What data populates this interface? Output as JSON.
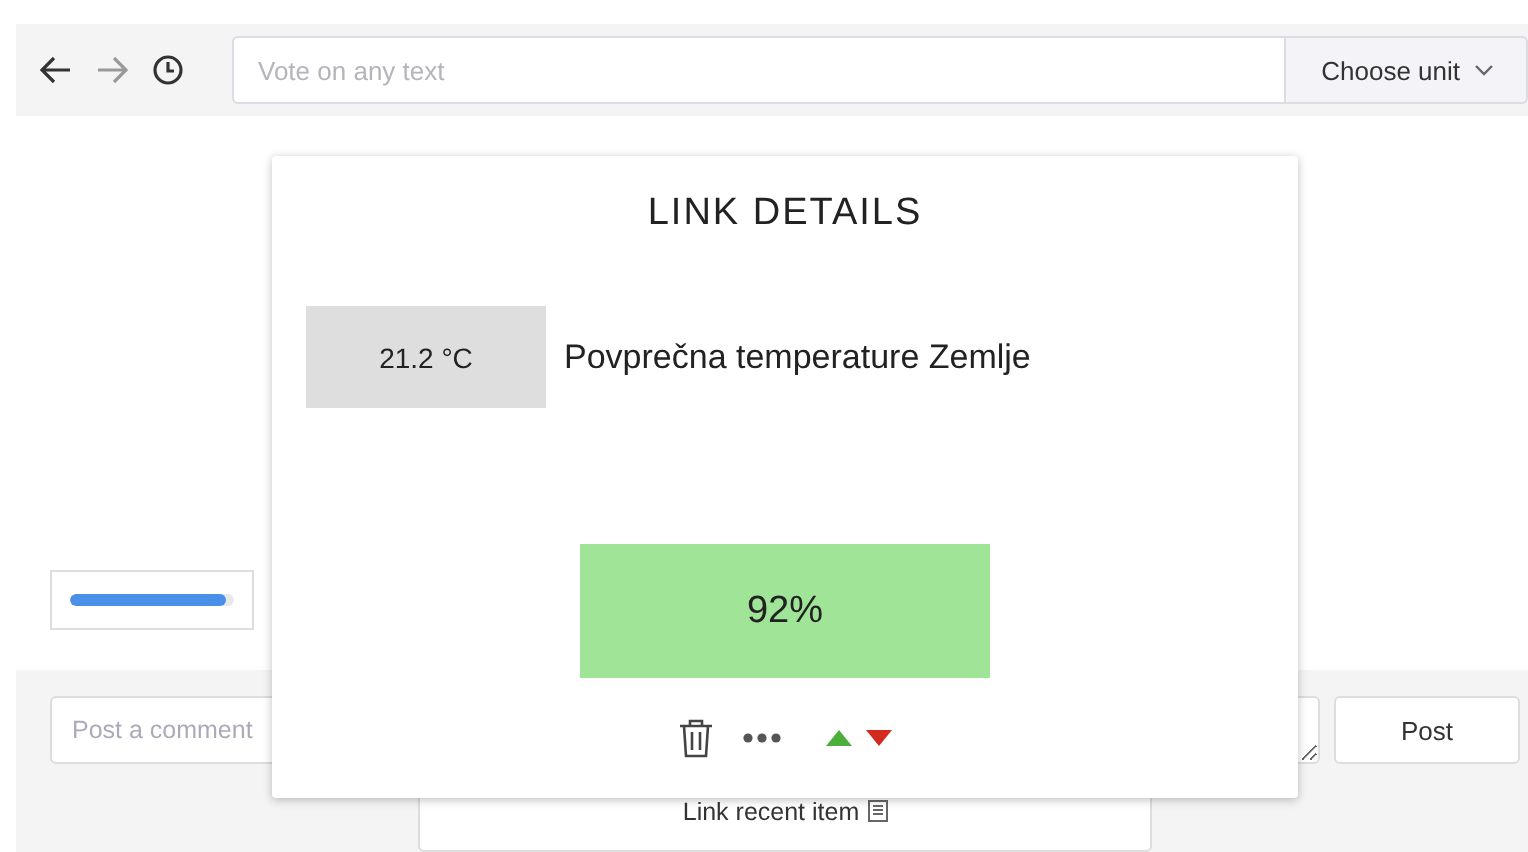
{
  "toolbar": {
    "nav": [
      {
        "kind": "back",
        "disabled": false
      },
      {
        "kind": "forward",
        "disabled": true
      },
      {
        "kind": "history",
        "disabled": false
      }
    ],
    "search": {
      "placeholder": "Vote on any text"
    },
    "unit_button": "Choose unit"
  },
  "progress": {
    "level": 0.95
  },
  "comment": {
    "placeholder": "Post a comment",
    "button": "Post"
  },
  "link_button": "Link recent item",
  "dialog": {
    "title": "LINK DETAILS",
    "value": "21.2 °C",
    "label": "Povprečna temperature Zemlje",
    "percent": "92%"
  }
}
